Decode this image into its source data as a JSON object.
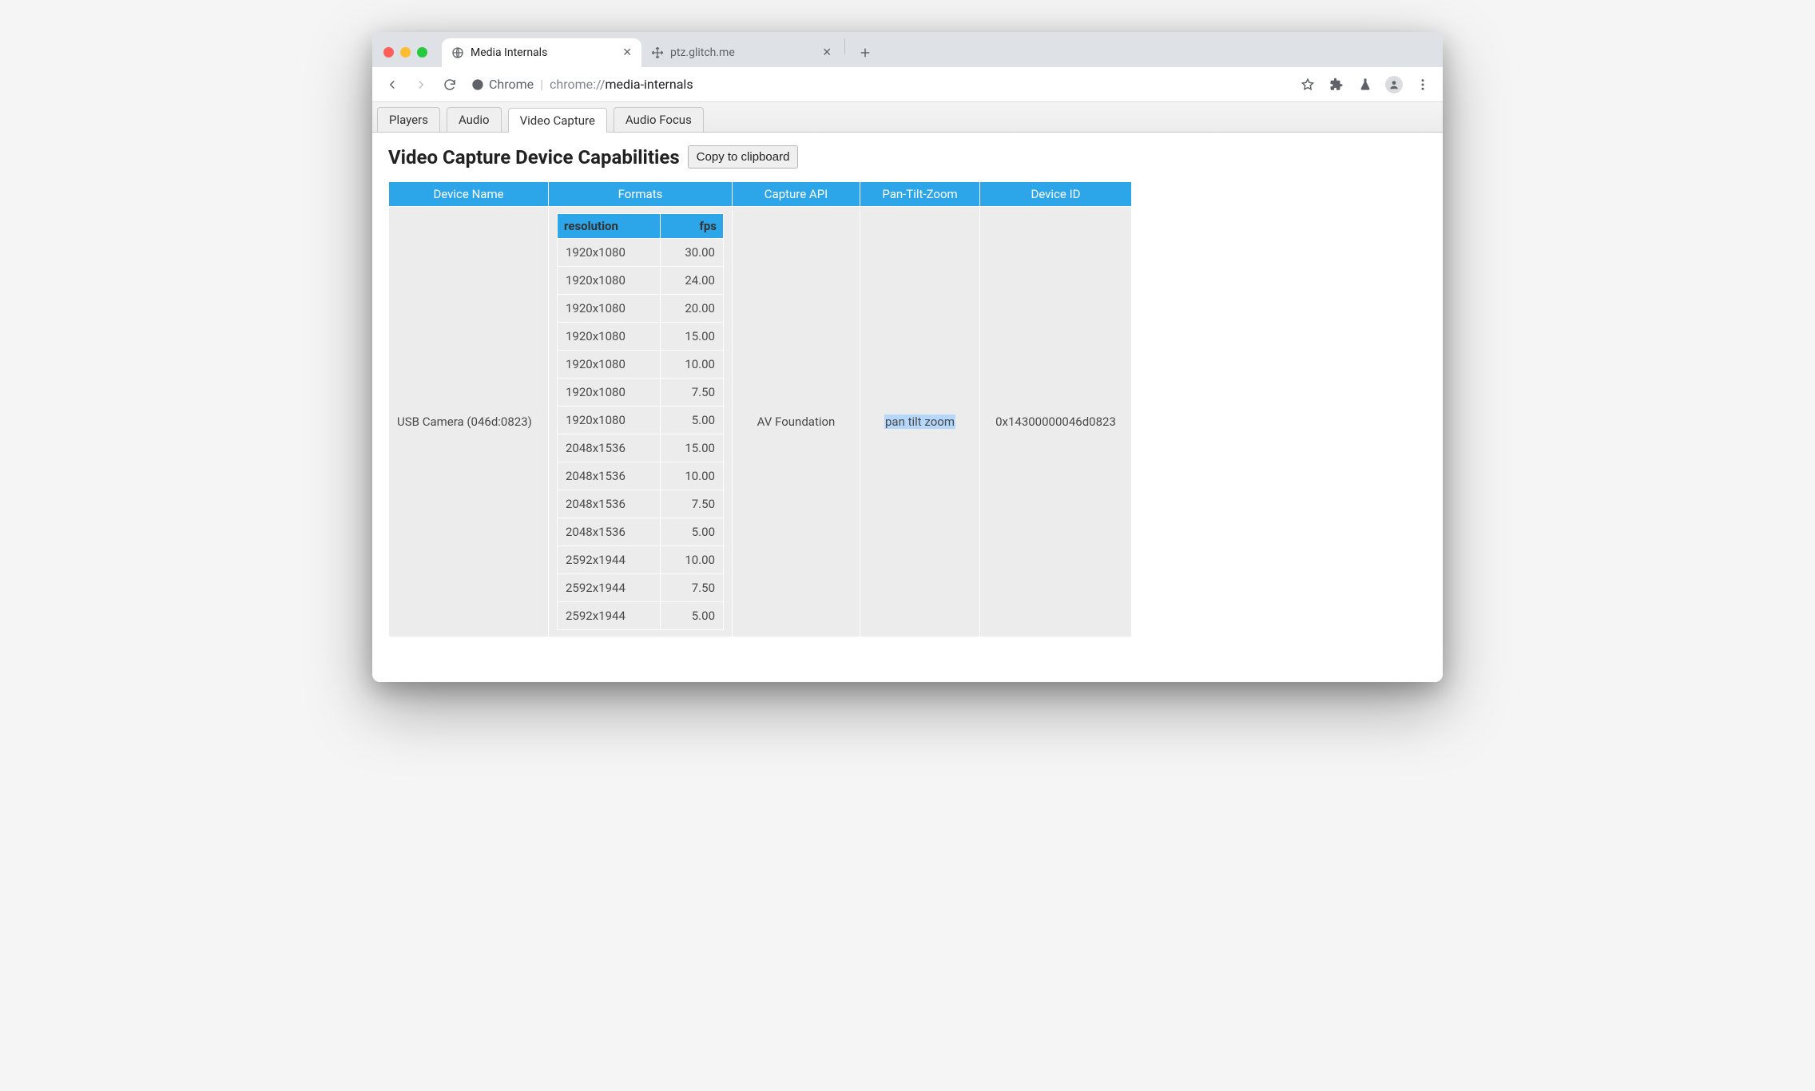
{
  "browser": {
    "tabs": [
      {
        "title": "Media Internals",
        "active": true
      },
      {
        "title": "ptz.glitch.me",
        "active": false
      }
    ],
    "url_origin_label": "Chrome",
    "url_muted": "chrome://",
    "url_strong": "media-internals"
  },
  "page_tabs": {
    "items": [
      "Players",
      "Audio",
      "Video Capture",
      "Audio Focus"
    ],
    "active_index": 2
  },
  "heading": "Video Capture Device Capabilities",
  "copy_button_label": "Copy to clipboard",
  "table": {
    "columns": [
      "Device Name",
      "Formats",
      "Capture API",
      "Pan-Tilt-Zoom",
      "Device ID"
    ],
    "formats_header": {
      "resolution": "resolution",
      "fps": "fps"
    },
    "rows": [
      {
        "device_name": "USB Camera (046d:0823)",
        "capture_api": "AV Foundation",
        "ptz": "pan tilt zoom",
        "device_id": "0x14300000046d0823",
        "formats": [
          {
            "res": "1920x1080",
            "fps": "30.00"
          },
          {
            "res": "1920x1080",
            "fps": "24.00"
          },
          {
            "res": "1920x1080",
            "fps": "20.00"
          },
          {
            "res": "1920x1080",
            "fps": "15.00"
          },
          {
            "res": "1920x1080",
            "fps": "10.00"
          },
          {
            "res": "1920x1080",
            "fps": "7.50"
          },
          {
            "res": "1920x1080",
            "fps": "5.00"
          },
          {
            "res": "2048x1536",
            "fps": "15.00"
          },
          {
            "res": "2048x1536",
            "fps": "10.00"
          },
          {
            "res": "2048x1536",
            "fps": "7.50"
          },
          {
            "res": "2048x1536",
            "fps": "5.00"
          },
          {
            "res": "2592x1944",
            "fps": "10.00"
          },
          {
            "res": "2592x1944",
            "fps": "7.50"
          },
          {
            "res": "2592x1944",
            "fps": "5.00"
          }
        ]
      }
    ]
  }
}
